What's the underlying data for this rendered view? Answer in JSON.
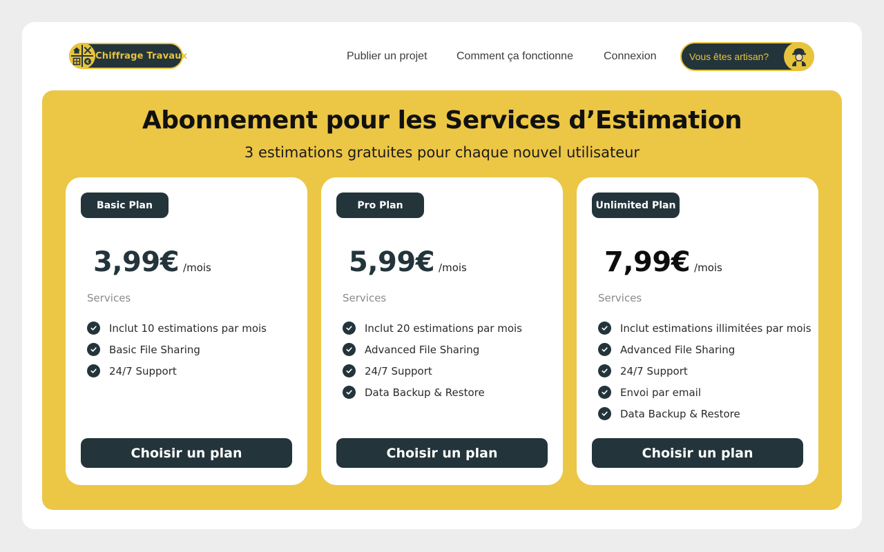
{
  "header": {
    "logo_text": "Chiffrage Travaux",
    "nav": [
      "Publier un projet",
      "Comment ça fonctionne",
      "Connexion"
    ],
    "artisan_button": "Vous êtes artisan?"
  },
  "hero": {
    "title": "Abonnement pour les Services d’Estimation",
    "subtitle": "3 estimations gratuites pour chaque nouvel utilisateur"
  },
  "plans": [
    {
      "name": "Basic Plan",
      "price": "3,99€",
      "period": "/mois",
      "services_label": "Services",
      "features": [
        "Inclut 10 estimations par mois",
        "Basic File Sharing",
        "24/7 Support"
      ],
      "cta": "Choisir un plan"
    },
    {
      "name": "Pro Plan",
      "price": "5,99€",
      "period": "/mois",
      "services_label": "Services",
      "features": [
        "Inclut 20 estimations par mois",
        "Advanced File Sharing",
        "24/7 Support",
        "Data Backup & Restore"
      ],
      "cta": "Choisir un plan"
    },
    {
      "name": "Unlimited Plan",
      "price": "7,99€",
      "period": "/mois",
      "services_label": "Services",
      "features": [
        "Inclut estimations illimitées par mois",
        "Advanced File Sharing",
        "24/7 Support",
        "Envoi par email",
        "Data Backup & Restore"
      ],
      "cta": "Choisir un plan"
    }
  ],
  "colors": {
    "accent_yellow": "#ecc645",
    "dark_slate": "#23343b",
    "page_background": "#ededed"
  },
  "icons": {
    "logo": "house-tools-logo-icon",
    "artisan": "worker-avatar-icon",
    "feature": "check-circle-icon"
  }
}
